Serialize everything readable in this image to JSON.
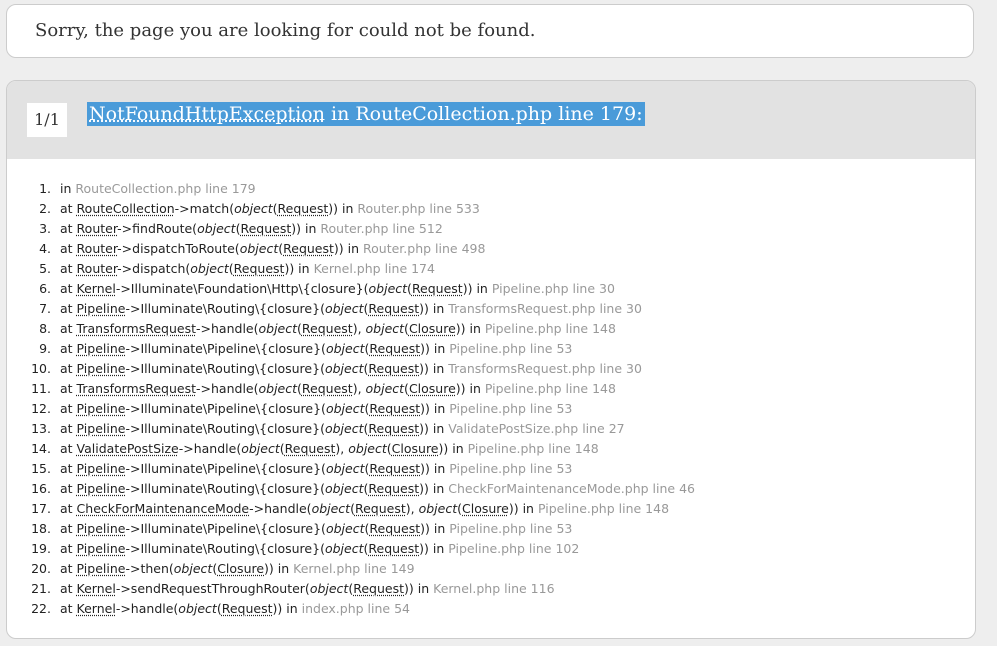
{
  "message": "Sorry, the page you are looking for could not be found.",
  "exception": {
    "count": "1/1",
    "class_name": "NotFoundHttpException",
    "location": " in RouteCollection.php line 179:"
  },
  "colors": {
    "selection_highlight": "#4a9bd9",
    "header_background": "#e2e2e2",
    "file_text": "#999999"
  },
  "trace": [
    {
      "num": "1.",
      "parts": [
        {
          "t": "in "
        },
        {
          "t": "RouteCollection.php line 179",
          "s": "file"
        }
      ]
    },
    {
      "num": "2.",
      "parts": [
        {
          "t": "at "
        },
        {
          "t": "RouteCollection",
          "s": "cls"
        },
        {
          "t": "->match("
        },
        {
          "t": "object",
          "s": "it"
        },
        {
          "t": "("
        },
        {
          "t": "Request",
          "s": "cls"
        },
        {
          "t": ")) in "
        },
        {
          "t": "Router.php line 533",
          "s": "file"
        }
      ]
    },
    {
      "num": "3.",
      "parts": [
        {
          "t": "at "
        },
        {
          "t": "Router",
          "s": "cls"
        },
        {
          "t": "->findRoute("
        },
        {
          "t": "object",
          "s": "it"
        },
        {
          "t": "("
        },
        {
          "t": "Request",
          "s": "cls"
        },
        {
          "t": ")) in "
        },
        {
          "t": "Router.php line 512",
          "s": "file"
        }
      ]
    },
    {
      "num": "4.",
      "parts": [
        {
          "t": "at "
        },
        {
          "t": "Router",
          "s": "cls"
        },
        {
          "t": "->dispatchToRoute("
        },
        {
          "t": "object",
          "s": "it"
        },
        {
          "t": "("
        },
        {
          "t": "Request",
          "s": "cls"
        },
        {
          "t": ")) in "
        },
        {
          "t": "Router.php line 498",
          "s": "file"
        }
      ]
    },
    {
      "num": "5.",
      "parts": [
        {
          "t": "at "
        },
        {
          "t": "Router",
          "s": "cls"
        },
        {
          "t": "->dispatch("
        },
        {
          "t": "object",
          "s": "it"
        },
        {
          "t": "("
        },
        {
          "t": "Request",
          "s": "cls"
        },
        {
          "t": ")) in "
        },
        {
          "t": "Kernel.php line 174",
          "s": "file"
        }
      ]
    },
    {
      "num": "6.",
      "parts": [
        {
          "t": "at "
        },
        {
          "t": "Kernel",
          "s": "cls"
        },
        {
          "t": "->Illuminate\\Foundation\\Http\\{closure}("
        },
        {
          "t": "object",
          "s": "it"
        },
        {
          "t": "("
        },
        {
          "t": "Request",
          "s": "cls"
        },
        {
          "t": ")) in "
        },
        {
          "t": "Pipeline.php line 30",
          "s": "file"
        }
      ]
    },
    {
      "num": "7.",
      "parts": [
        {
          "t": "at "
        },
        {
          "t": "Pipeline",
          "s": "cls"
        },
        {
          "t": "->Illuminate\\Routing\\{closure}("
        },
        {
          "t": "object",
          "s": "it"
        },
        {
          "t": "("
        },
        {
          "t": "Request",
          "s": "cls"
        },
        {
          "t": ")) in "
        },
        {
          "t": "TransformsRequest.php line 30",
          "s": "file"
        }
      ]
    },
    {
      "num": "8.",
      "parts": [
        {
          "t": "at "
        },
        {
          "t": "TransformsRequest",
          "s": "cls"
        },
        {
          "t": "->handle("
        },
        {
          "t": "object",
          "s": "it"
        },
        {
          "t": "("
        },
        {
          "t": "Request",
          "s": "cls"
        },
        {
          "t": "), "
        },
        {
          "t": "object",
          "s": "it"
        },
        {
          "t": "("
        },
        {
          "t": "Closure",
          "s": "cls"
        },
        {
          "t": ")) in "
        },
        {
          "t": "Pipeline.php line 148",
          "s": "file"
        }
      ]
    },
    {
      "num": "9.",
      "parts": [
        {
          "t": "at "
        },
        {
          "t": "Pipeline",
          "s": "cls"
        },
        {
          "t": "->Illuminate\\Pipeline\\{closure}("
        },
        {
          "t": "object",
          "s": "it"
        },
        {
          "t": "("
        },
        {
          "t": "Request",
          "s": "cls"
        },
        {
          "t": ")) in "
        },
        {
          "t": "Pipeline.php line 53",
          "s": "file"
        }
      ]
    },
    {
      "num": "10.",
      "parts": [
        {
          "t": "at "
        },
        {
          "t": "Pipeline",
          "s": "cls"
        },
        {
          "t": "->Illuminate\\Routing\\{closure}("
        },
        {
          "t": "object",
          "s": "it"
        },
        {
          "t": "("
        },
        {
          "t": "Request",
          "s": "cls"
        },
        {
          "t": ")) in "
        },
        {
          "t": "TransformsRequest.php line 30",
          "s": "file"
        }
      ]
    },
    {
      "num": "11.",
      "parts": [
        {
          "t": "at "
        },
        {
          "t": "TransformsRequest",
          "s": "cls"
        },
        {
          "t": "->handle("
        },
        {
          "t": "object",
          "s": "it"
        },
        {
          "t": "("
        },
        {
          "t": "Request",
          "s": "cls"
        },
        {
          "t": "), "
        },
        {
          "t": "object",
          "s": "it"
        },
        {
          "t": "("
        },
        {
          "t": "Closure",
          "s": "cls"
        },
        {
          "t": ")) in "
        },
        {
          "t": "Pipeline.php line 148",
          "s": "file"
        }
      ]
    },
    {
      "num": "12.",
      "parts": [
        {
          "t": "at "
        },
        {
          "t": "Pipeline",
          "s": "cls"
        },
        {
          "t": "->Illuminate\\Pipeline\\{closure}("
        },
        {
          "t": "object",
          "s": "it"
        },
        {
          "t": "("
        },
        {
          "t": "Request",
          "s": "cls"
        },
        {
          "t": ")) in "
        },
        {
          "t": "Pipeline.php line 53",
          "s": "file"
        }
      ]
    },
    {
      "num": "13.",
      "parts": [
        {
          "t": "at "
        },
        {
          "t": "Pipeline",
          "s": "cls"
        },
        {
          "t": "->Illuminate\\Routing\\{closure}("
        },
        {
          "t": "object",
          "s": "it"
        },
        {
          "t": "("
        },
        {
          "t": "Request",
          "s": "cls"
        },
        {
          "t": ")) in "
        },
        {
          "t": "ValidatePostSize.php line 27",
          "s": "file"
        }
      ]
    },
    {
      "num": "14.",
      "parts": [
        {
          "t": "at "
        },
        {
          "t": "ValidatePostSize",
          "s": "cls"
        },
        {
          "t": "->handle("
        },
        {
          "t": "object",
          "s": "it"
        },
        {
          "t": "("
        },
        {
          "t": "Request",
          "s": "cls"
        },
        {
          "t": "), "
        },
        {
          "t": "object",
          "s": "it"
        },
        {
          "t": "("
        },
        {
          "t": "Closure",
          "s": "cls"
        },
        {
          "t": ")) in "
        },
        {
          "t": "Pipeline.php line 148",
          "s": "file"
        }
      ]
    },
    {
      "num": "15.",
      "parts": [
        {
          "t": "at "
        },
        {
          "t": "Pipeline",
          "s": "cls"
        },
        {
          "t": "->Illuminate\\Pipeline\\{closure}("
        },
        {
          "t": "object",
          "s": "it"
        },
        {
          "t": "("
        },
        {
          "t": "Request",
          "s": "cls"
        },
        {
          "t": ")) in "
        },
        {
          "t": "Pipeline.php line 53",
          "s": "file"
        }
      ]
    },
    {
      "num": "16.",
      "parts": [
        {
          "t": "at "
        },
        {
          "t": "Pipeline",
          "s": "cls"
        },
        {
          "t": "->Illuminate\\Routing\\{closure}("
        },
        {
          "t": "object",
          "s": "it"
        },
        {
          "t": "("
        },
        {
          "t": "Request",
          "s": "cls"
        },
        {
          "t": ")) in "
        },
        {
          "t": "CheckForMaintenanceMode.php line 46",
          "s": "file"
        }
      ]
    },
    {
      "num": "17.",
      "parts": [
        {
          "t": "at "
        },
        {
          "t": "CheckForMaintenanceMode",
          "s": "cls"
        },
        {
          "t": "->handle("
        },
        {
          "t": "object",
          "s": "it"
        },
        {
          "t": "("
        },
        {
          "t": "Request",
          "s": "cls"
        },
        {
          "t": "), "
        },
        {
          "t": "object",
          "s": "it"
        },
        {
          "t": "("
        },
        {
          "t": "Closure",
          "s": "cls"
        },
        {
          "t": ")) in "
        },
        {
          "t": "Pipeline.php line 148",
          "s": "file"
        }
      ]
    },
    {
      "num": "18.",
      "parts": [
        {
          "t": "at "
        },
        {
          "t": "Pipeline",
          "s": "cls"
        },
        {
          "t": "->Illuminate\\Pipeline\\{closure}("
        },
        {
          "t": "object",
          "s": "it"
        },
        {
          "t": "("
        },
        {
          "t": "Request",
          "s": "cls"
        },
        {
          "t": ")) in "
        },
        {
          "t": "Pipeline.php line 53",
          "s": "file"
        }
      ]
    },
    {
      "num": "19.",
      "parts": [
        {
          "t": "at "
        },
        {
          "t": "Pipeline",
          "s": "cls"
        },
        {
          "t": "->Illuminate\\Routing\\{closure}("
        },
        {
          "t": "object",
          "s": "it"
        },
        {
          "t": "("
        },
        {
          "t": "Request",
          "s": "cls"
        },
        {
          "t": ")) in "
        },
        {
          "t": "Pipeline.php line 102",
          "s": "file"
        }
      ]
    },
    {
      "num": "20.",
      "parts": [
        {
          "t": "at "
        },
        {
          "t": "Pipeline",
          "s": "cls"
        },
        {
          "t": "->then("
        },
        {
          "t": "object",
          "s": "it"
        },
        {
          "t": "("
        },
        {
          "t": "Closure",
          "s": "cls"
        },
        {
          "t": ")) in "
        },
        {
          "t": "Kernel.php line 149",
          "s": "file"
        }
      ]
    },
    {
      "num": "21.",
      "parts": [
        {
          "t": "at "
        },
        {
          "t": "Kernel",
          "s": "cls"
        },
        {
          "t": "->sendRequestThroughRouter("
        },
        {
          "t": "object",
          "s": "it"
        },
        {
          "t": "("
        },
        {
          "t": "Request",
          "s": "cls"
        },
        {
          "t": ")) in "
        },
        {
          "t": "Kernel.php line 116",
          "s": "file"
        }
      ]
    },
    {
      "num": "22.",
      "parts": [
        {
          "t": "at "
        },
        {
          "t": "Kernel",
          "s": "cls"
        },
        {
          "t": "->handle("
        },
        {
          "t": "object",
          "s": "it"
        },
        {
          "t": "("
        },
        {
          "t": "Request",
          "s": "cls"
        },
        {
          "t": ")) in "
        },
        {
          "t": "index.php line 54",
          "s": "file"
        }
      ]
    }
  ]
}
